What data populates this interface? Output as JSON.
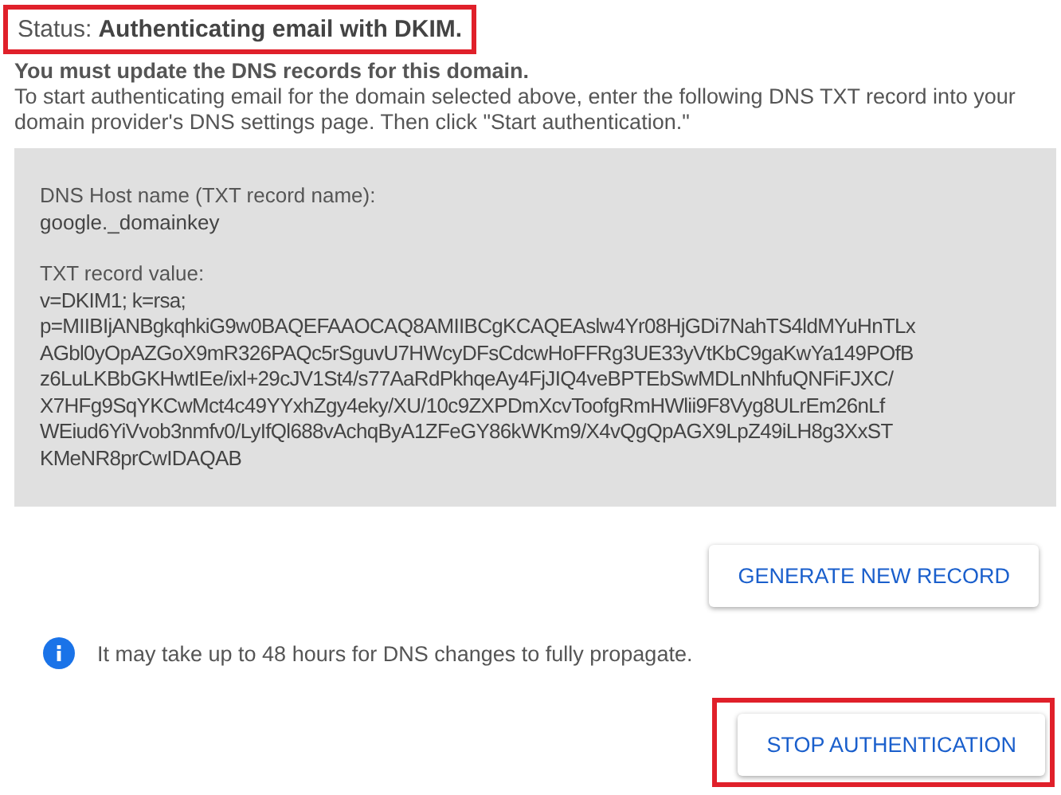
{
  "status": {
    "label": "Status:",
    "value": "Authenticating email with DKIM.",
    "highlighted": true
  },
  "heading": "You must update the DNS records for this domain.",
  "instructions": "To start authenticating email for the domain selected above, enter the following DNS TXT record into your domain provider's DNS settings page. Then click \"Start authentication.\"",
  "record": {
    "host_label": "DNS Host name (TXT record name):",
    "host_value": "google._domainkey",
    "value_label": "TXT record value:",
    "value_lines": [
      "v=DKIM1; k=rsa;",
      "p=MIIBIjANBgkqhkiG9w0BAQEFAAOCAQ8AMIIBCgKCAQEAslw4Yr08HjGDi7NahTS4ldMYuHnTLx",
      "AGbl0yOpAZGoX9mR326PAQc5rSguvU7HWcyDFsCdcwHoFFRg3UE33yVtKbC9gaKwYa149POfB",
      "z6LuLKBbGKHwtIEe/ixl+29cJV1St4/s77AaRdPkhqeAy4FjJIQ4veBPTEbSwMDLnNhfuQNFiFJXC/",
      "X7HFg9SqYKCwMct4c49YYxhZgy4eky/XU/10c9ZXPDmXcvToofgRmHWlii9F8Vyg8ULrEm26nLf",
      "WEiud6YiVvob3nmfv0/LyIfQl688vAchqByA1ZFeGY86kWKm9/X4vQgQpAGX9LpZ49iLH8g3XxST",
      "KMeNR8prCwIDAQAB"
    ]
  },
  "generate_button": {
    "label": "GENERATE NEW RECORD",
    "highlighted": false
  },
  "notice": "It may take up to 48 hours for DNS changes to fully propagate.",
  "stop_button": {
    "label": "STOP AUTHENTICATION",
    "highlighted": true
  }
}
